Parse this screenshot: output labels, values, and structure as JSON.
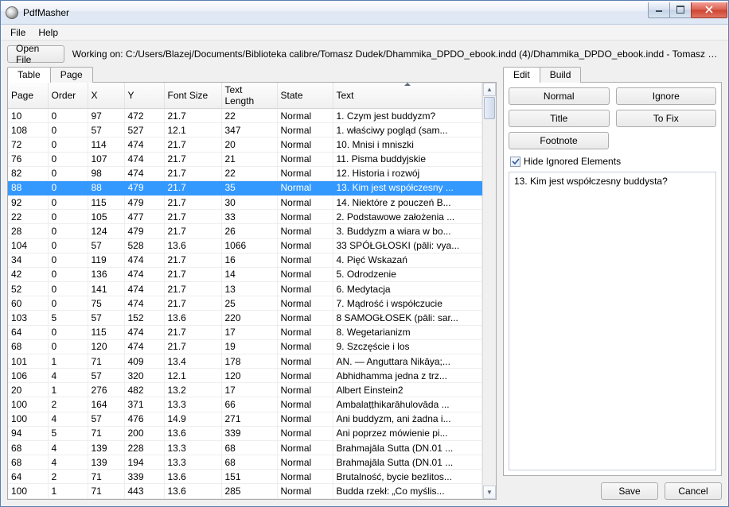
{
  "window": {
    "title": "PdfMasher"
  },
  "menu": {
    "file": "File",
    "help": "Help"
  },
  "toolbar": {
    "open_file": "Open File",
    "working_on": "Working on: C:/Users/Blazej/Documents/Biblioteka calibre/Tomasz Dudek/Dhammika_DPDO_ebook.indd (4)/Dhammika_DPDO_ebook.indd - Tomasz Dudek.pdf"
  },
  "left_tabs": {
    "table": "Table",
    "page": "Page"
  },
  "columns": {
    "page": "Page",
    "order": "Order",
    "x": "X",
    "y": "Y",
    "font_size": "Font Size",
    "text_length": "Text Length",
    "state": "State",
    "text": "Text"
  },
  "rows": [
    {
      "page": "10",
      "order": "0",
      "x": "97",
      "y": "472",
      "fs": "21.7",
      "tl": "22",
      "state": "Normal",
      "text": "1. Czym jest buddyzm?"
    },
    {
      "page": "108",
      "order": "0",
      "x": "57",
      "y": "527",
      "fs": "12.1",
      "tl": "347",
      "state": "Normal",
      "text": "1. właściwy pogląd (sam..."
    },
    {
      "page": "72",
      "order": "0",
      "x": "114",
      "y": "474",
      "fs": "21.7",
      "tl": "20",
      "state": "Normal",
      "text": "10. Mnisi i mniszki"
    },
    {
      "page": "76",
      "order": "0",
      "x": "107",
      "y": "474",
      "fs": "21.7",
      "tl": "21",
      "state": "Normal",
      "text": "11. Pisma buddyjskie"
    },
    {
      "page": "82",
      "order": "0",
      "x": "98",
      "y": "474",
      "fs": "21.7",
      "tl": "22",
      "state": "Normal",
      "text": "12. Historia i rozwój"
    },
    {
      "page": "88",
      "order": "0",
      "x": "88",
      "y": "479",
      "fs": "21.7",
      "tl": "35",
      "state": "Normal",
      "text": "13. Kim jest współczesny ...",
      "selected": true
    },
    {
      "page": "92",
      "order": "0",
      "x": "115",
      "y": "479",
      "fs": "21.7",
      "tl": "30",
      "state": "Normal",
      "text": "14. Niektóre z pouczeń B..."
    },
    {
      "page": "22",
      "order": "0",
      "x": "105",
      "y": "477",
      "fs": "21.7",
      "tl": "33",
      "state": "Normal",
      "text": "2. Podstawowe założenia ..."
    },
    {
      "page": "28",
      "order": "0",
      "x": "124",
      "y": "479",
      "fs": "21.7",
      "tl": "26",
      "state": "Normal",
      "text": "3. Buddyzm a wiara w bo..."
    },
    {
      "page": "104",
      "order": "0",
      "x": "57",
      "y": "528",
      "fs": "13.6",
      "tl": "1066",
      "state": "Normal",
      "text": "33 SPÓŁGŁOSKI (pāli: vya..."
    },
    {
      "page": "34",
      "order": "0",
      "x": "119",
      "y": "474",
      "fs": "21.7",
      "tl": "16",
      "state": "Normal",
      "text": "4. Pięć Wskazań"
    },
    {
      "page": "42",
      "order": "0",
      "x": "136",
      "y": "474",
      "fs": "21.7",
      "tl": "14",
      "state": "Normal",
      "text": "5. Odrodzenie"
    },
    {
      "page": "52",
      "order": "0",
      "x": "141",
      "y": "474",
      "fs": "21.7",
      "tl": "13",
      "state": "Normal",
      "text": "6. Medytacja"
    },
    {
      "page": "60",
      "order": "0",
      "x": "75",
      "y": "474",
      "fs": "21.7",
      "tl": "25",
      "state": "Normal",
      "text": "7. Mądrość i współczucie"
    },
    {
      "page": "103",
      "order": "5",
      "x": "57",
      "y": "152",
      "fs": "13.6",
      "tl": "220",
      "state": "Normal",
      "text": "8 SAMOGŁOSEK (pāli: sar..."
    },
    {
      "page": "64",
      "order": "0",
      "x": "115",
      "y": "474",
      "fs": "21.7",
      "tl": "17",
      "state": "Normal",
      "text": "8. Wegetarianizm"
    },
    {
      "page": "68",
      "order": "0",
      "x": "120",
      "y": "474",
      "fs": "21.7",
      "tl": "19",
      "state": "Normal",
      "text": "9. Szczęście i los"
    },
    {
      "page": "101",
      "order": "1",
      "x": "71",
      "y": "409",
      "fs": "13.4",
      "tl": "178",
      "state": "Normal",
      "text": "AN. — Anguttara Nikāya;..."
    },
    {
      "page": "106",
      "order": "4",
      "x": "57",
      "y": "320",
      "fs": "12.1",
      "tl": "120",
      "state": "Normal",
      "text": "Abhidhamma jedna z trz..."
    },
    {
      "page": "20",
      "order": "1",
      "x": "276",
      "y": "482",
      "fs": "13.2",
      "tl": "17",
      "state": "Normal",
      "text": "Albert Einstein2"
    },
    {
      "page": "100",
      "order": "2",
      "x": "164",
      "y": "371",
      "fs": "13.3",
      "tl": "66",
      "state": "Normal",
      "text": "Ambalaṭṭhikarāhulovāda ..."
    },
    {
      "page": "100",
      "order": "4",
      "x": "57",
      "y": "476",
      "fs": "14.9",
      "tl": "271",
      "state": "Normal",
      "text": "Ani buddyzm, ani żadna i..."
    },
    {
      "page": "94",
      "order": "5",
      "x": "71",
      "y": "200",
      "fs": "13.6",
      "tl": "339",
      "state": "Normal",
      "text": "Ani poprzez mówienie pi..."
    },
    {
      "page": "68",
      "order": "4",
      "x": "139",
      "y": "228",
      "fs": "13.3",
      "tl": "68",
      "state": "Normal",
      "text": "Brahmajāla Sutta (DN.01 ..."
    },
    {
      "page": "68",
      "order": "4",
      "x": "139",
      "y": "194",
      "fs": "13.3",
      "tl": "68",
      "state": "Normal",
      "text": "Brahmajāla Sutta (DN.01 ..."
    },
    {
      "page": "64",
      "order": "2",
      "x": "71",
      "y": "339",
      "fs": "13.6",
      "tl": "151",
      "state": "Normal",
      "text": "Brutalność, bycie bezlitos..."
    },
    {
      "page": "100",
      "order": "1",
      "x": "71",
      "y": "443",
      "fs": "13.6",
      "tl": "285",
      "state": "Normal",
      "text": "Budda rzekł: „Co myślis..."
    }
  ],
  "right_tabs": {
    "edit": "Edit",
    "build": "Build"
  },
  "right": {
    "normal": "Normal",
    "ignore": "Ignore",
    "title": "Title",
    "tofix": "To Fix",
    "footnote": "Footnote",
    "hide_ignored": "Hide Ignored Elements",
    "textarea_value": "13. Kim jest współczesny buddysta?",
    "save": "Save",
    "cancel": "Cancel"
  }
}
